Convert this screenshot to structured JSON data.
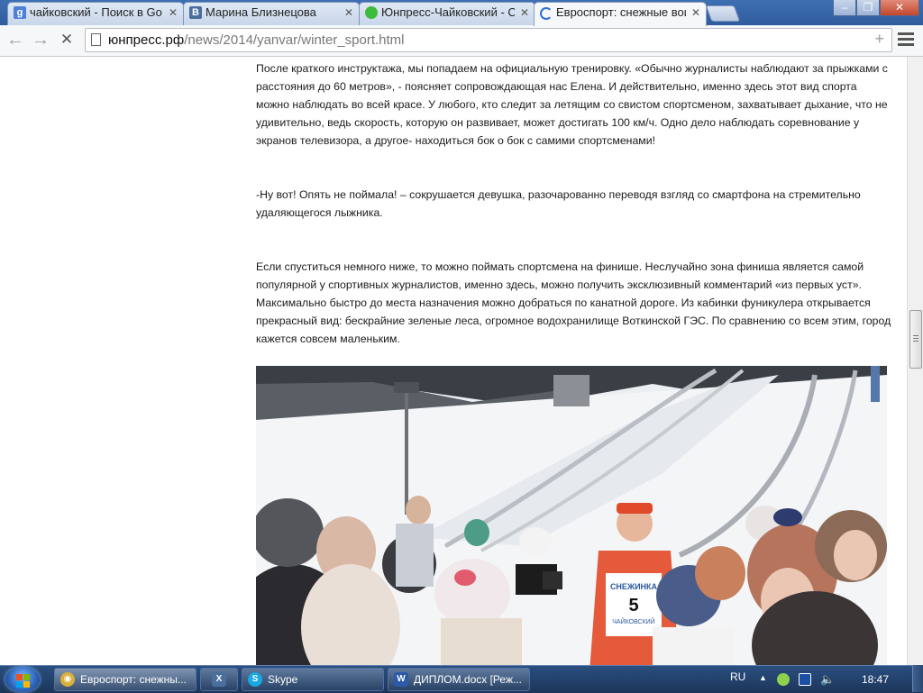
{
  "tabs": [
    {
      "title": "чайковский - Поиск в Go",
      "favicon": "google-icon",
      "color": "#4f7fd8",
      "letter": "g"
    },
    {
      "title": "Марина Близнецова",
      "favicon": "vk-icon",
      "color": "#4a6f9c",
      "letter": "В"
    },
    {
      "title": "Юнпресс-Чайковский - С",
      "favicon": "apple-green-icon",
      "color": "#3dbb3d",
      "letter": ""
    },
    {
      "title": "Евроспорт: снежные вои",
      "favicon": "loading-spinner-icon",
      "color": "#ffffff",
      "letter": ""
    }
  ],
  "tab_close_glyph": "✕",
  "toolbar": {
    "back_glyph": "←",
    "forward_glyph": "→",
    "stop_glyph": "✕",
    "url_host": "юнпресс.рф",
    "url_path": "/news/2014/yanvar/winter_sport.html",
    "star_glyph": "+"
  },
  "article": {
    "paragraphs": [
      "После краткого инструктажа, мы попадаем на официальную тренировку.  «Обычно журналисты наблюдают за прыжками с расстояния до 60 метров», -  поясняет сопровождающая нас  Елена. И действительно, именно здесь этот вид спорта можно наблюдать во всей красе. У любого, кто следит  за летящим со свистом спортсменом, захватывает дыхание, что не удивительно, ведь скорость, которую он развивает, может достигать 100 км/ч.  Одно дело наблюдать соревнование у экранов телевизора, а другое- находиться бок о бок с самими спортсменами!",
      "-Ну вот! Опять не поймала! – сокрушается девушка, разочарованно переводя взгляд со смартфона на стремительно удаляющегося лыжника.",
      "Если спуститься немного ниже, то можно поймать спортсмена на финише. Неслучайно зона финиша является самой популярной у спортивных журналистов, именно здесь, можно получить эксклюзивный комментарий «из первых уст». Максимально быстро до места назначения можно добраться по канатной дороге. Из кабинки фуникулера открывается прекрасный вид: бескрайние зеленые леса, огромное водохранилище Воткинской ГЭС. По сравнению со всем этим, город кажется совсем маленьким."
    ],
    "photo": {
      "bib_title": "СНЕЖИНКА",
      "bib_number": "5",
      "bib_city": "ЧАЙКОВСКИЙ"
    }
  },
  "taskbar": {
    "items": [
      {
        "label": "Евроспорт: снежны...",
        "icon": "chrome-icon",
        "color": "#d9b13a",
        "letter": "◉"
      },
      {
        "label": "",
        "icon": "xnview-icon",
        "color": "#4a6f9c",
        "letter": "X"
      },
      {
        "label": "Skype",
        "icon": "skype-icon",
        "color": "#17a9e3",
        "letter": "S"
      },
      {
        "label": "ДИПЛОМ.docx [Реж...",
        "icon": "word-icon",
        "color": "#2b5aa8",
        "letter": "W"
      }
    ],
    "lang": "RU",
    "tray_up_glyph": "▲",
    "clock": "18:47"
  }
}
